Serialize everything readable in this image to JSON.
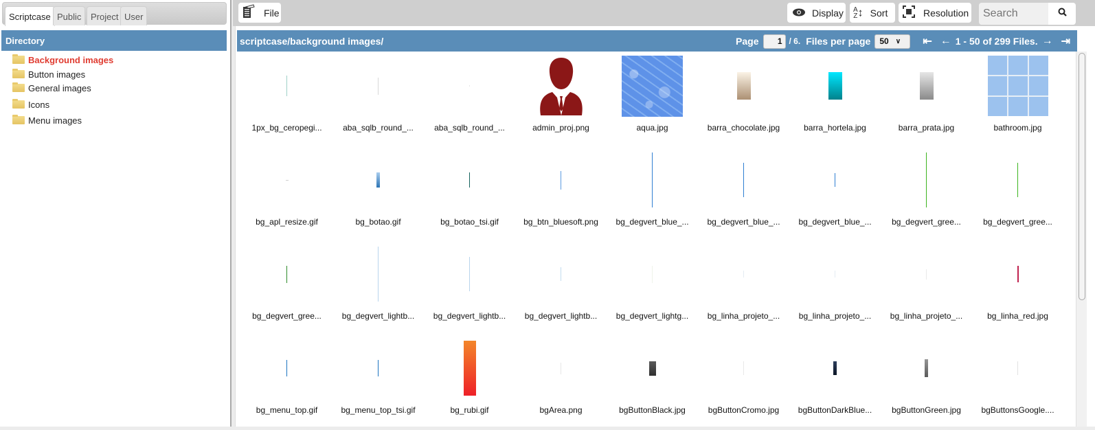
{
  "left_panel": {
    "tabs": [
      {
        "label": "Scriptcase",
        "active": true
      },
      {
        "label": "Public",
        "active": false
      },
      {
        "label": "Project",
        "active": false
      },
      {
        "label": "User",
        "active": false
      }
    ],
    "directory_header": "Directory",
    "folders": [
      {
        "label": "Background images",
        "active": true
      },
      {
        "label": "Button images",
        "active": false
      },
      {
        "label": "General images",
        "active": false
      },
      {
        "label": "Icons",
        "active": false
      },
      {
        "label": "Menu images",
        "active": false
      }
    ]
  },
  "toolbar": {
    "file_label": "File",
    "display_label": "Display",
    "sort_label": "Sort",
    "resolution_label": "Resolution",
    "search_placeholder": "Search"
  },
  "pathbar": {
    "path": "scriptcase/background images/",
    "page_label": "Page",
    "current_page": "1",
    "total_pages": "/ 6.",
    "files_per_page_label": "Files per page",
    "files_per_page": "50",
    "range_text": "1 - 50 of 299 Files."
  },
  "colors": {
    "header_blue": "#5a8db8",
    "active_folder": "#e03c31"
  },
  "files": [
    {
      "name": "1px_bg_ceropegi...",
      "thumb": {
        "kind": "line",
        "color": "#9fd0c8",
        "w": 1,
        "h": 30
      }
    },
    {
      "name": "aba_sqlb_round_...",
      "thumb": {
        "kind": "line",
        "color": "#d8d8d8",
        "w": 1,
        "h": 25
      }
    },
    {
      "name": "aba_sqlb_round_...",
      "thumb": {
        "kind": "line",
        "color": "#e6e6e6",
        "w": 1,
        "h": 2
      }
    },
    {
      "name": "admin_proj.png",
      "thumb": {
        "kind": "person",
        "color": "#8b1717"
      }
    },
    {
      "name": "aqua.jpg",
      "thumb": {
        "kind": "water",
        "color": "#5e92e8"
      }
    },
    {
      "name": "barra_chocolate.jpg",
      "thumb": {
        "kind": "grad",
        "from": "#fbf3e6",
        "to": "#ac9073",
        "w": 20,
        "h": 40
      }
    },
    {
      "name": "barra_hortela.jpg",
      "thumb": {
        "kind": "grad",
        "from": "#00e7ff",
        "to": "#00828c",
        "w": 20,
        "h": 40
      }
    },
    {
      "name": "barra_prata.jpg",
      "thumb": {
        "kind": "grad",
        "from": "#e6e6e6",
        "to": "#8a8a8a",
        "w": 20,
        "h": 40
      }
    },
    {
      "name": "bathroom.jpg",
      "thumb": {
        "kind": "tiles",
        "color": "#9cc2ee"
      }
    },
    {
      "name": "bg_apl_resize.gif",
      "thumb": {
        "kind": "line",
        "color": "#d0d0d0",
        "w": 4,
        "h": 1
      }
    },
    {
      "name": "bg_botao.gif",
      "thumb": {
        "kind": "grad",
        "from": "#a9cdee",
        "to": "#2c74b4",
        "w": 5,
        "h": 22
      }
    },
    {
      "name": "bg_botao_tsi.gif",
      "thumb": {
        "kind": "line",
        "color": "#16635e",
        "w": 1,
        "h": 22
      }
    },
    {
      "name": "bg_btn_bluesoft.png",
      "thumb": {
        "kind": "line",
        "color": "#5b9be0",
        "w": 1,
        "h": 27
      }
    },
    {
      "name": "bg_degvert_blue_...",
      "thumb": {
        "kind": "line",
        "color": "#2e7ed2",
        "w": 1,
        "h": 80
      }
    },
    {
      "name": "bg_degvert_blue_...",
      "thumb": {
        "kind": "line",
        "color": "#2e7ed2",
        "w": 1,
        "h": 50
      }
    },
    {
      "name": "bg_degvert_blue_...",
      "thumb": {
        "kind": "line",
        "color": "#2e7ed2",
        "w": 1,
        "h": 20
      }
    },
    {
      "name": "bg_degvert_gree...",
      "thumb": {
        "kind": "line",
        "color": "#3cb41e",
        "w": 1,
        "h": 80
      }
    },
    {
      "name": "bg_degvert_gree...",
      "thumb": {
        "kind": "line",
        "color": "#3cb41e",
        "w": 1,
        "h": 50
      }
    },
    {
      "name": "bg_degvert_gree...",
      "thumb": {
        "kind": "line",
        "color": "#2e8b2a",
        "w": 1,
        "h": 25
      }
    },
    {
      "name": "bg_degvert_lightb...",
      "thumb": {
        "kind": "line",
        "color": "#b8d4ec",
        "w": 1,
        "h": 80
      }
    },
    {
      "name": "bg_degvert_lightb...",
      "thumb": {
        "kind": "line",
        "color": "#b8d4ec",
        "w": 1,
        "h": 50
      }
    },
    {
      "name": "bg_degvert_lightb...",
      "thumb": {
        "kind": "line",
        "color": "#c2dbef",
        "w": 1,
        "h": 20
      }
    },
    {
      "name": "bg_degvert_lightg...",
      "thumb": {
        "kind": "line",
        "color": "#eef4ea",
        "w": 1,
        "h": 25
      }
    },
    {
      "name": "bg_linha_projeto_...",
      "thumb": {
        "kind": "line",
        "color": "#e4ecf3",
        "w": 1,
        "h": 10
      }
    },
    {
      "name": "bg_linha_projeto_...",
      "thumb": {
        "kind": "line",
        "color": "#e4ecf3",
        "w": 1,
        "h": 10
      }
    },
    {
      "name": "bg_linha_projeto_...",
      "thumb": {
        "kind": "line",
        "color": "#eaeaea",
        "w": 1,
        "h": 15
      }
    },
    {
      "name": "bg_linha_red.jpg",
      "thumb": {
        "kind": "line",
        "color": "#c0234f",
        "w": 2,
        "h": 24
      }
    },
    {
      "name": "bg_menu_top.gif",
      "thumb": {
        "kind": "line",
        "color": "#1c74c0",
        "w": 1,
        "h": 24
      }
    },
    {
      "name": "bg_menu_top_tsi.gif",
      "thumb": {
        "kind": "line",
        "color": "#1c74c0",
        "w": 1,
        "h": 24
      }
    },
    {
      "name": "bg_rubi.gif",
      "thumb": {
        "kind": "grad",
        "from": "#f3862a",
        "to": "#ee2128",
        "w": 18,
        "h": 80
      }
    },
    {
      "name": "bgArea.png",
      "thumb": {
        "kind": "line",
        "color": "#e6e6e6",
        "w": 1,
        "h": 17
      }
    },
    {
      "name": "bgButtonBlack.jpg",
      "thumb": {
        "kind": "grad",
        "from": "#5a5a5a",
        "to": "#303030",
        "w": 10,
        "h": 21
      }
    },
    {
      "name": "bgButtonCromo.jpg",
      "thumb": {
        "kind": "line",
        "color": "#e8e8e8",
        "w": 1,
        "h": 20
      }
    },
    {
      "name": "bgButtonDarkBlue...",
      "thumb": {
        "kind": "grad",
        "from": "#2d3e5c",
        "to": "#0d1626",
        "w": 5,
        "h": 20
      }
    },
    {
      "name": "bgButtonGreen.jpg",
      "thumb": {
        "kind": "grad",
        "from": "#959595",
        "to": "#5a5a5a",
        "w": 5,
        "h": 26
      }
    },
    {
      "name": "bgButtonsGoogle....",
      "thumb": {
        "kind": "line",
        "color": "#e2e2e2",
        "w": 1,
        "h": 20
      }
    }
  ]
}
